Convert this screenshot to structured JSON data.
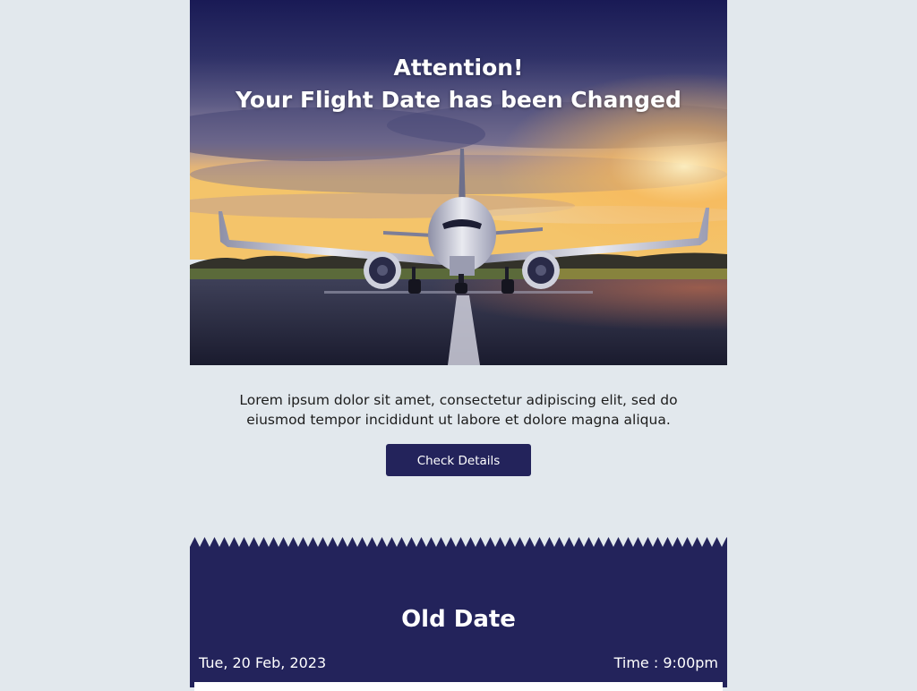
{
  "hero": {
    "title_line1": "Attention!",
    "title_line2": "Your Flight Date has been Changed",
    "image": "airplane-on-runway-at-sunset"
  },
  "intro": {
    "text": "Lorem ipsum dolor sit amet, consectetur adipiscing elit, sed do eiusmod tempor incididunt ut labore et dolore magna aliqua.",
    "button_label": "Check Details"
  },
  "old_date": {
    "title": "Old Date",
    "date": "Tue, 20 Feb, 2023",
    "time": "Time : 9:00pm"
  },
  "colors": {
    "page_bg": "#e2e8ed",
    "brand_navy": "#23235b",
    "text_white": "#ffffff"
  }
}
